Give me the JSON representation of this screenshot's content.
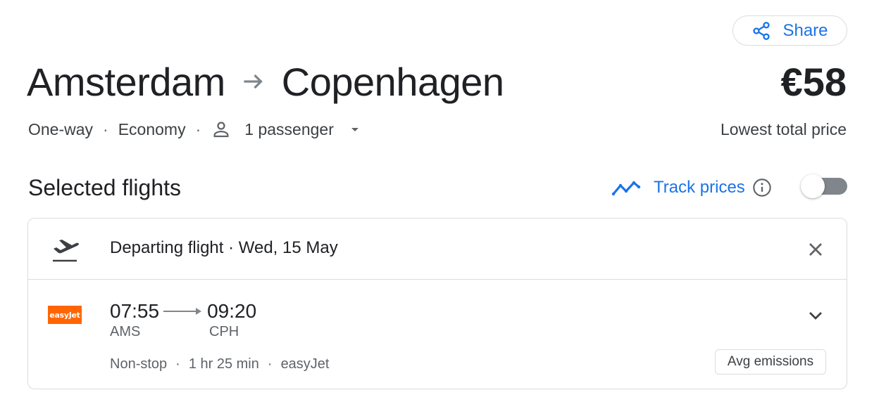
{
  "share": {
    "label": "Share",
    "icon": "share-icon"
  },
  "route": {
    "origin": "Amsterdam",
    "destination": "Copenhagen",
    "arrow_icon": "arrow-right-icon"
  },
  "price": {
    "value": "€58",
    "label": "Lowest total price"
  },
  "trip": {
    "type": "One-way",
    "cabin": "Economy",
    "passengers": "1 passenger",
    "separator": "·"
  },
  "section": {
    "title": "Selected flights"
  },
  "track_prices": {
    "label": "Track prices",
    "enabled": false
  },
  "departing": {
    "header": "Departing flight · Wed, 15 May",
    "airline_logo_text": "easyJet",
    "depart_time": "07:55",
    "arrive_time": "09:20",
    "depart_airport": "AMS",
    "arrive_airport": "CPH",
    "stops": "Non-stop",
    "duration": "1 hr 25 min",
    "airline": "easyJet",
    "separator": "·",
    "emissions": "Avg emissions"
  },
  "colors": {
    "accent": "#1a73e8",
    "airline_brand": "#ff6600",
    "text": "#202124",
    "muted": "#5f6368",
    "border": "#dadce0"
  }
}
